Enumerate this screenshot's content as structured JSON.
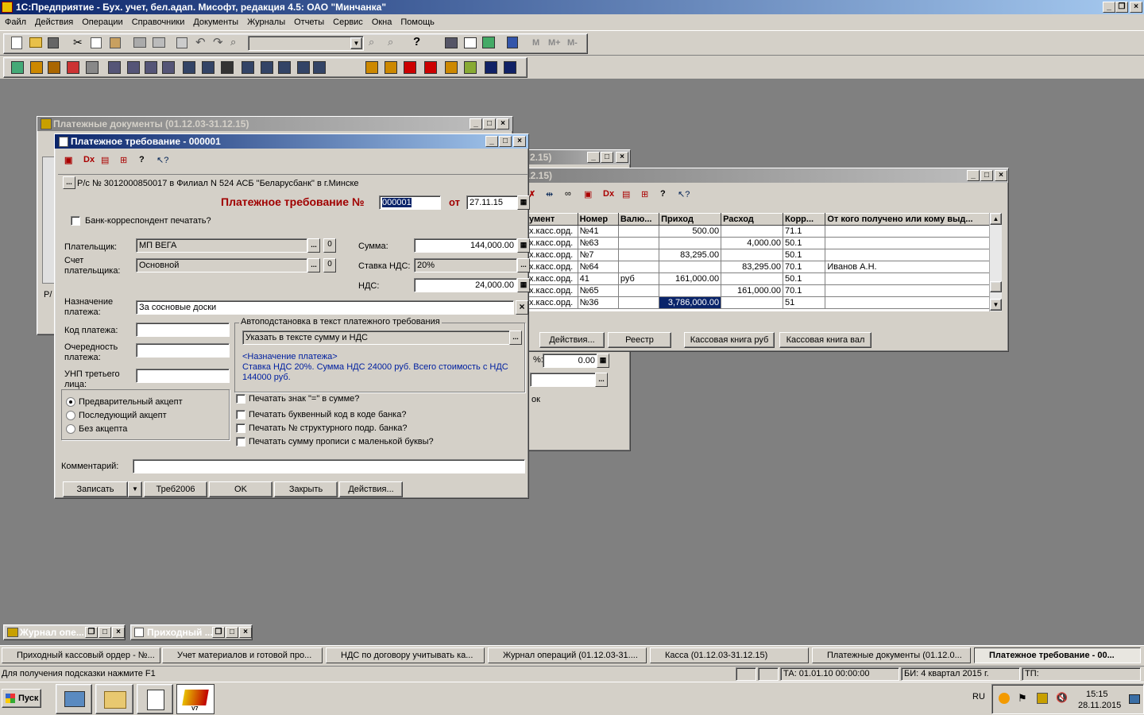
{
  "app": {
    "title": "1С:Предприятие - Бух. учет, бел.адап. Мисофт, редакция 4.5: ОАО \"Минчанка\""
  },
  "menu": [
    "Файл",
    "Действия",
    "Операции",
    "Справочники",
    "Документы",
    "Журналы",
    "Отчеты",
    "Сервис",
    "Окна",
    "Помощь"
  ],
  "toolbar": {
    "m_buttons": [
      "M",
      "M+",
      "M-"
    ]
  },
  "win_payments": {
    "title": "Платежные документы (01.12.03-31.12.15)",
    "left_label": "Р/"
  },
  "win_back": {
    "title_partial": "2.15)",
    "percent_field": "0.00",
    "note_partial": "ок"
  },
  "win_kassa": {
    "title_partial": "12.15)",
    "columns": [
      "умент",
      "Номер",
      "Валю...",
      "Приход",
      "Расход",
      "Корр...",
      "От кого получено или кому выд..."
    ],
    "rows": [
      [
        "х.касс.орд.",
        "№41",
        "",
        "500.00",
        "",
        "71.1",
        ""
      ],
      [
        "х.касс.орд.",
        "№63",
        "",
        "",
        "4,000.00",
        "50.1",
        ""
      ],
      [
        "х.касс.орд.",
        "№7",
        "",
        "83,295.00",
        "",
        "50.1",
        ""
      ],
      [
        "х.касс.орд.",
        "№64",
        "",
        "",
        "83,295.00",
        "70.1",
        "Иванов А.Н."
      ],
      [
        "х.касс.орд.",
        "41",
        "руб",
        "161,000.00",
        "",
        "50.1",
        ""
      ],
      [
        "х.касс.орд.",
        "№65",
        "",
        "",
        "161,000.00",
        "70.1",
        ""
      ],
      [
        "х.касс.орд.",
        "№36",
        "",
        "3,786,000.00",
        "",
        "51",
        ""
      ]
    ],
    "buttons": [
      "Действия...",
      "Реестр",
      "Кассовая книга руб",
      "Кассовая книга вал"
    ]
  },
  "form": {
    "title": "Платежное требование - 000001",
    "account": "Р/с № 3012000850017 в Филиал N 524 АСБ \"Беларусбанк\" в г.Минске",
    "heading": "Платежное требование №",
    "number": "000001",
    "date_label": "от",
    "date": "27.11.15",
    "bank_print": "Банк-корреспондент печатать?",
    "payer_label": "Плательщик:",
    "payer": "МП ВЕГА",
    "payer_acc_label1": "Счет",
    "payer_acc_label2": "плательщика:",
    "payer_acc": "Основной",
    "zero": "0",
    "sum_label": "Сумма:",
    "sum": "144,000.00",
    "vat_rate_label": "Ставка НДС:",
    "vat_rate": "20%",
    "vat_label": "НДС:",
    "vat": "24,000.00",
    "purpose_label1": "Назначение",
    "purpose_label2": "платежа:",
    "purpose": "За сосновые доски",
    "code_label": "Код платежа:",
    "order_label1": "Очередность",
    "order_label2": "платежа:",
    "unp_label1": "УНП третьего",
    "unp_label2": "лица:",
    "auto_group": "Автоподстановка в текст платежного требования",
    "auto_option": "Указать в тексте сумму и НДС",
    "auto_text1": "<Назначение платежа>",
    "auto_text2": "Ставка НДС 20%. Сумма НДС 24000 руб. Всего стоимость с НДС",
    "auto_text3": "144000 руб.",
    "radios": [
      "Предварительный акцепт",
      "Последующий акцепт",
      "Без акцепта"
    ],
    "checks": [
      "Печатать знак \"=\" в сумме?",
      "Печатать буквенный код в коде банка?",
      "Печатать № структурного подр. банка?",
      "Печатать сумму прописи с маленькой буквы?"
    ],
    "comment_label": "Комментарий:",
    "buttons": {
      "save": "Записать",
      "form": "Треб2006",
      "ok": "OK",
      "close": "Закрыть",
      "actions": "Действия..."
    }
  },
  "minimized": [
    "Журнал опе...",
    "Приходный ..."
  ],
  "tasks": [
    "Приходный кассовый ордер - №...",
    "Учет материалов и готовой про...",
    "НДС по договору учитывать ка...",
    "Журнал операций  (01.12.03-31....",
    "Касса (01.12.03-31.12.15)",
    "Платежные документы (01.12.0...",
    "Платежное требование - 00..."
  ],
  "status": {
    "hint": "Для получения подсказки нажмите F1",
    "ta": "ТА: 01.01.10  00:00:00",
    "bi": "БИ: 4 квартал 2015 г.",
    "tp": "ТП:"
  },
  "taskbar": {
    "start": "Пуск",
    "lang": "RU",
    "time": "15:15",
    "date": "28.11.2015",
    "v7": "V7"
  }
}
